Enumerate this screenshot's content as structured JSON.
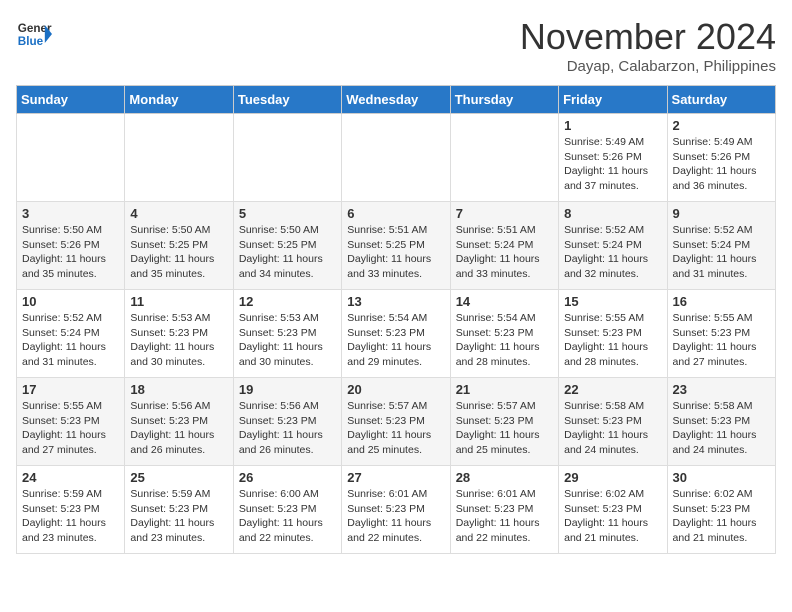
{
  "logo": {
    "line1": "General",
    "line2": "Blue"
  },
  "title": "November 2024",
  "location": "Dayap, Calabarzon, Philippines",
  "weekdays": [
    "Sunday",
    "Monday",
    "Tuesday",
    "Wednesday",
    "Thursday",
    "Friday",
    "Saturday"
  ],
  "weeks": [
    [
      {
        "day": "",
        "info": ""
      },
      {
        "day": "",
        "info": ""
      },
      {
        "day": "",
        "info": ""
      },
      {
        "day": "",
        "info": ""
      },
      {
        "day": "",
        "info": ""
      },
      {
        "day": "1",
        "info": "Sunrise: 5:49 AM\nSunset: 5:26 PM\nDaylight: 11 hours\nand 37 minutes."
      },
      {
        "day": "2",
        "info": "Sunrise: 5:49 AM\nSunset: 5:26 PM\nDaylight: 11 hours\nand 36 minutes."
      }
    ],
    [
      {
        "day": "3",
        "info": "Sunrise: 5:50 AM\nSunset: 5:26 PM\nDaylight: 11 hours\nand 35 minutes."
      },
      {
        "day": "4",
        "info": "Sunrise: 5:50 AM\nSunset: 5:25 PM\nDaylight: 11 hours\nand 35 minutes."
      },
      {
        "day": "5",
        "info": "Sunrise: 5:50 AM\nSunset: 5:25 PM\nDaylight: 11 hours\nand 34 minutes."
      },
      {
        "day": "6",
        "info": "Sunrise: 5:51 AM\nSunset: 5:25 PM\nDaylight: 11 hours\nand 33 minutes."
      },
      {
        "day": "7",
        "info": "Sunrise: 5:51 AM\nSunset: 5:24 PM\nDaylight: 11 hours\nand 33 minutes."
      },
      {
        "day": "8",
        "info": "Sunrise: 5:52 AM\nSunset: 5:24 PM\nDaylight: 11 hours\nand 32 minutes."
      },
      {
        "day": "9",
        "info": "Sunrise: 5:52 AM\nSunset: 5:24 PM\nDaylight: 11 hours\nand 31 minutes."
      }
    ],
    [
      {
        "day": "10",
        "info": "Sunrise: 5:52 AM\nSunset: 5:24 PM\nDaylight: 11 hours\nand 31 minutes."
      },
      {
        "day": "11",
        "info": "Sunrise: 5:53 AM\nSunset: 5:23 PM\nDaylight: 11 hours\nand 30 minutes."
      },
      {
        "day": "12",
        "info": "Sunrise: 5:53 AM\nSunset: 5:23 PM\nDaylight: 11 hours\nand 30 minutes."
      },
      {
        "day": "13",
        "info": "Sunrise: 5:54 AM\nSunset: 5:23 PM\nDaylight: 11 hours\nand 29 minutes."
      },
      {
        "day": "14",
        "info": "Sunrise: 5:54 AM\nSunset: 5:23 PM\nDaylight: 11 hours\nand 28 minutes."
      },
      {
        "day": "15",
        "info": "Sunrise: 5:55 AM\nSunset: 5:23 PM\nDaylight: 11 hours\nand 28 minutes."
      },
      {
        "day": "16",
        "info": "Sunrise: 5:55 AM\nSunset: 5:23 PM\nDaylight: 11 hours\nand 27 minutes."
      }
    ],
    [
      {
        "day": "17",
        "info": "Sunrise: 5:55 AM\nSunset: 5:23 PM\nDaylight: 11 hours\nand 27 minutes."
      },
      {
        "day": "18",
        "info": "Sunrise: 5:56 AM\nSunset: 5:23 PM\nDaylight: 11 hours\nand 26 minutes."
      },
      {
        "day": "19",
        "info": "Sunrise: 5:56 AM\nSunset: 5:23 PM\nDaylight: 11 hours\nand 26 minutes."
      },
      {
        "day": "20",
        "info": "Sunrise: 5:57 AM\nSunset: 5:23 PM\nDaylight: 11 hours\nand 25 minutes."
      },
      {
        "day": "21",
        "info": "Sunrise: 5:57 AM\nSunset: 5:23 PM\nDaylight: 11 hours\nand 25 minutes."
      },
      {
        "day": "22",
        "info": "Sunrise: 5:58 AM\nSunset: 5:23 PM\nDaylight: 11 hours\nand 24 minutes."
      },
      {
        "day": "23",
        "info": "Sunrise: 5:58 AM\nSunset: 5:23 PM\nDaylight: 11 hours\nand 24 minutes."
      }
    ],
    [
      {
        "day": "24",
        "info": "Sunrise: 5:59 AM\nSunset: 5:23 PM\nDaylight: 11 hours\nand 23 minutes."
      },
      {
        "day": "25",
        "info": "Sunrise: 5:59 AM\nSunset: 5:23 PM\nDaylight: 11 hours\nand 23 minutes."
      },
      {
        "day": "26",
        "info": "Sunrise: 6:00 AM\nSunset: 5:23 PM\nDaylight: 11 hours\nand 22 minutes."
      },
      {
        "day": "27",
        "info": "Sunrise: 6:01 AM\nSunset: 5:23 PM\nDaylight: 11 hours\nand 22 minutes."
      },
      {
        "day": "28",
        "info": "Sunrise: 6:01 AM\nSunset: 5:23 PM\nDaylight: 11 hours\nand 22 minutes."
      },
      {
        "day": "29",
        "info": "Sunrise: 6:02 AM\nSunset: 5:23 PM\nDaylight: 11 hours\nand 21 minutes."
      },
      {
        "day": "30",
        "info": "Sunrise: 6:02 AM\nSunset: 5:23 PM\nDaylight: 11 hours\nand 21 minutes."
      }
    ]
  ]
}
